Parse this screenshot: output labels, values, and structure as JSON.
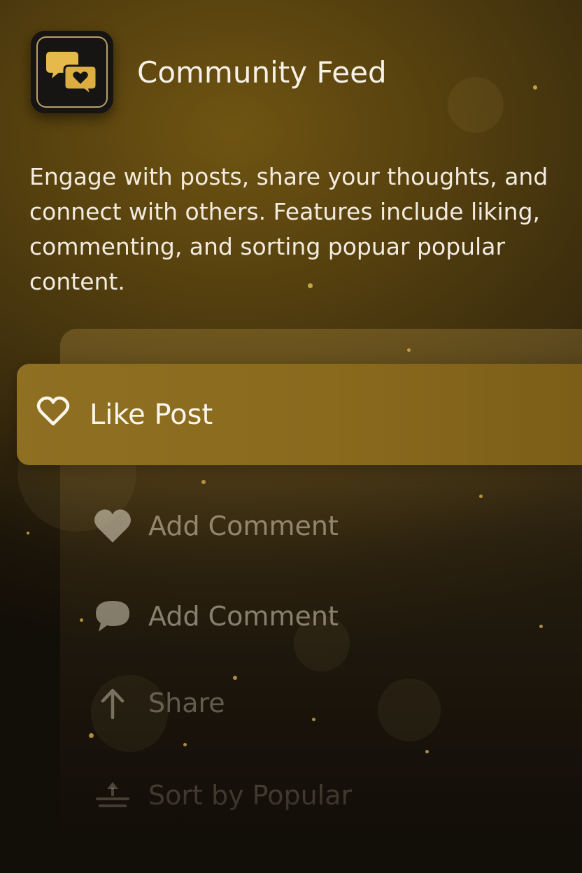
{
  "header": {
    "app_icon": "chat-bubbles-heart-icon",
    "title": "Community Feed"
  },
  "description": "Engage with posts, share your thoughts, and connect with others. Features include liking, commenting, and sorting popuar popular content.",
  "menu": {
    "selected": {
      "label": "Like Post",
      "icon": "heart-outline-icon"
    },
    "items": [
      {
        "label": "Add Comment",
        "icon": "heart-filled-icon"
      },
      {
        "label": "Add Comment",
        "icon": "speech-bubble-icon"
      },
      {
        "label": "Share",
        "icon": "arrow-up-icon"
      },
      {
        "label": "Sort by Popular",
        "icon": "sort-icon"
      }
    ]
  },
  "colors": {
    "accent_gold": "#c9a24a",
    "highlight": "#8f6f22",
    "background_dark": "#120e08"
  }
}
